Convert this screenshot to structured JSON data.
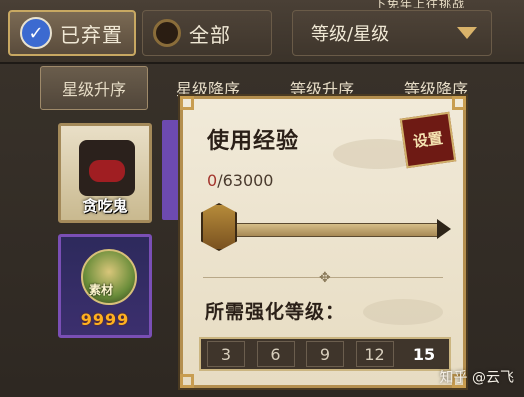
{
  "top_strip": "下免年上往挑战",
  "toolbar": {
    "discarded_label": "已弃置",
    "all_label": "全部",
    "dropdown_label": "等级/星级"
  },
  "sort_tabs": [
    {
      "label": "星级升序",
      "active": true
    },
    {
      "label": "星级降序",
      "active": false
    },
    {
      "label": "等级升序",
      "active": false
    },
    {
      "label": "等级降序",
      "active": false
    }
  ],
  "cards": [
    {
      "name": "贪吃鬼",
      "rarity": "N"
    },
    {
      "tag": "素材",
      "stars": "9999",
      "rarity": "purple"
    }
  ],
  "panel": {
    "title": "使用经验",
    "seal_label": "设置",
    "exp_current": "0",
    "exp_total": "/63000",
    "slider_value": 0,
    "required_label": "所需强化等级：",
    "levels": [
      "3",
      "6",
      "9",
      "12",
      "15"
    ],
    "selected_level": "15"
  },
  "watermark": "知乎 @云飞",
  "colors": {
    "accent_gold": "#c8a862",
    "check_blue": "#3c6ad0",
    "seal_red": "#6e1a14",
    "exp_red": "#a4362e"
  }
}
